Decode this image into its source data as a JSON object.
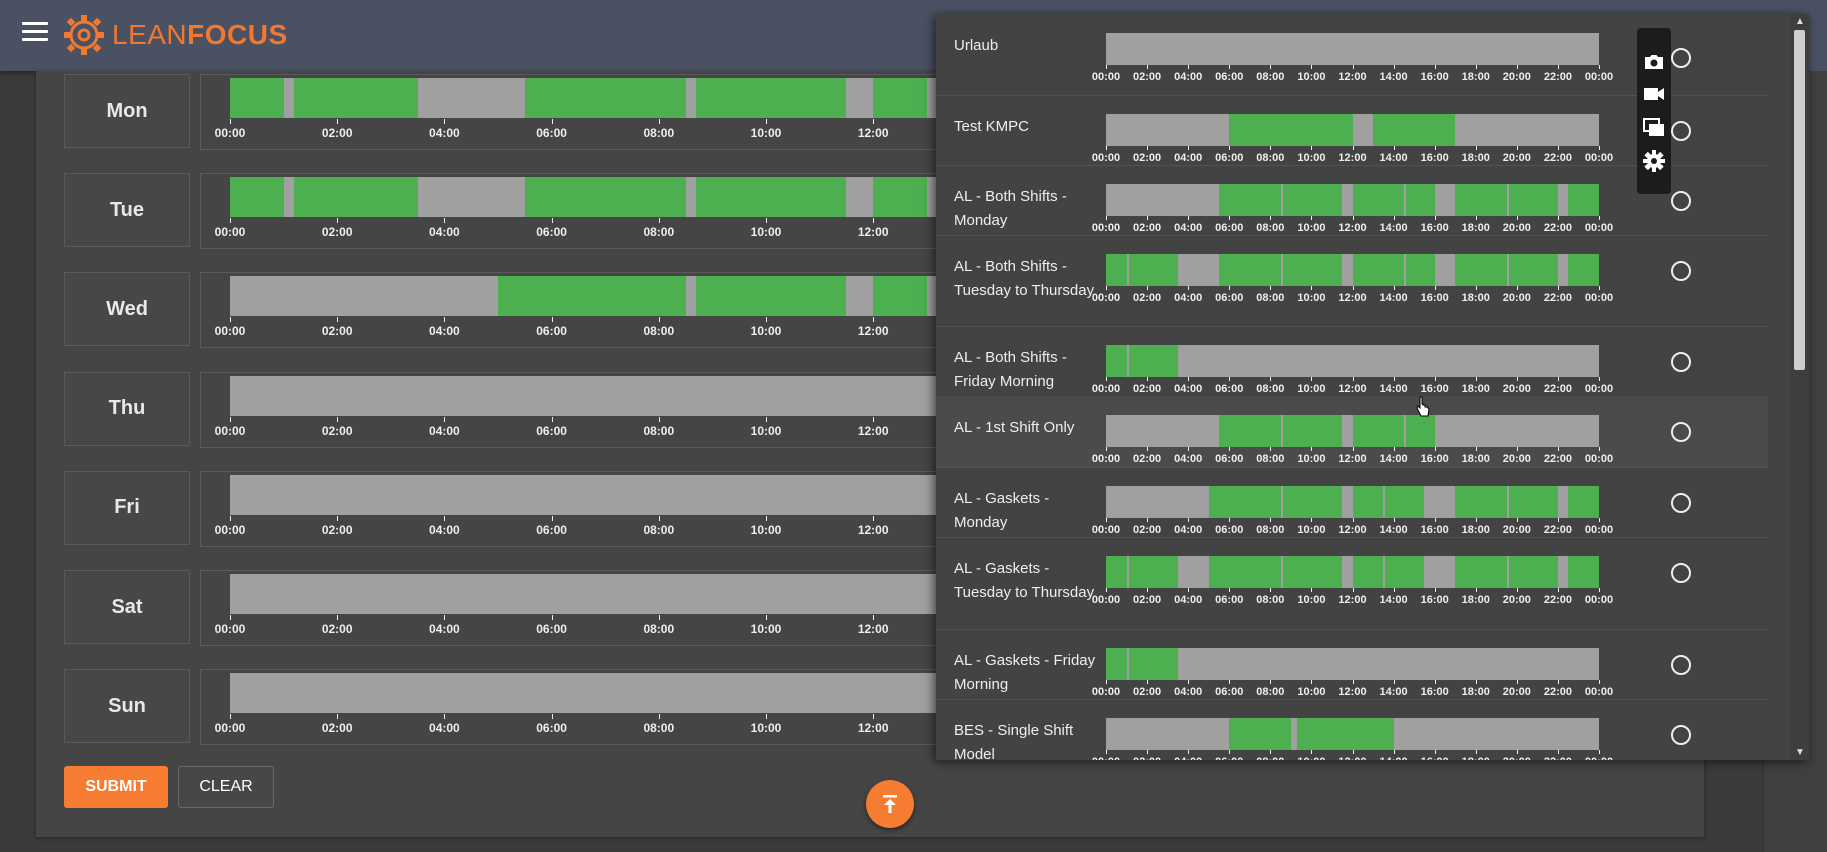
{
  "app": {
    "logo_text_light": "LEAN",
    "logo_text_bold": "FOCUS"
  },
  "hours": [
    "00:00",
    "02:00",
    "04:00",
    "06:00",
    "08:00",
    "10:00",
    "12:00",
    "14:00",
    "16:00",
    "18:00",
    "20:00",
    "22:00",
    "00:00"
  ],
  "main_axis_visible": [
    "00:00",
    "02:00",
    "04:00",
    "06:00",
    "08:00",
    "10:00",
    "12:00"
  ],
  "days": [
    {
      "label": "Mon",
      "segments": [
        [
          0,
          1.0
        ],
        [
          1.2,
          3.5
        ],
        [
          5.5,
          8.5
        ],
        [
          8.7,
          11.5
        ],
        [
          12.0,
          13.0
        ]
      ]
    },
    {
      "label": "Tue",
      "segments": [
        [
          0,
          1.0
        ],
        [
          1.2,
          3.5
        ],
        [
          5.5,
          8.5
        ],
        [
          8.7,
          11.5
        ],
        [
          12.0,
          13.0
        ]
      ]
    },
    {
      "label": "Wed",
      "segments": [
        [
          5.0,
          8.5
        ],
        [
          8.7,
          11.5
        ],
        [
          12.0,
          13.0
        ]
      ]
    },
    {
      "label": "Thu",
      "segments": []
    },
    {
      "label": "Fri",
      "segments": []
    },
    {
      "label": "Sat",
      "segments": []
    },
    {
      "label": "Sun",
      "segments": []
    }
  ],
  "buttons": {
    "submit": "SUBMIT",
    "clear": "CLEAR"
  },
  "models": [
    {
      "name": "Urlaub",
      "segments": []
    },
    {
      "name": "Test KMPC",
      "segments": [
        [
          6.0,
          12.0
        ],
        [
          13.0,
          17.0
        ]
      ]
    },
    {
      "name": "AL - Both Shifts - Monday",
      "segments": [
        [
          5.5,
          8.5
        ],
        [
          8.6,
          11.5
        ],
        [
          12.0,
          14.5
        ],
        [
          14.6,
          16.0
        ],
        [
          17.0,
          19.5
        ],
        [
          19.6,
          22.0
        ],
        [
          22.5,
          24.0
        ]
      ]
    },
    {
      "name": "AL - Both Shifts - Tuesday to Thursday",
      "segments": [
        [
          0,
          1.0
        ],
        [
          1.1,
          3.5
        ],
        [
          5.5,
          8.5
        ],
        [
          8.6,
          11.5
        ],
        [
          12.0,
          14.5
        ],
        [
          14.6,
          16.0
        ],
        [
          17.0,
          19.5
        ],
        [
          19.6,
          22.0
        ],
        [
          22.5,
          24.0
        ]
      ]
    },
    {
      "name": "AL - Both Shifts - Friday Morning",
      "segments": [
        [
          0,
          1.0
        ],
        [
          1.1,
          3.5
        ]
      ]
    },
    {
      "name": "AL - 1st Shift Only",
      "segments": [
        [
          5.5,
          8.5
        ],
        [
          8.6,
          11.5
        ],
        [
          12.0,
          14.5
        ],
        [
          14.6,
          16.0
        ]
      ]
    },
    {
      "name": "AL - Gaskets - Monday",
      "segments": [
        [
          5.0,
          8.5
        ],
        [
          8.6,
          11.5
        ],
        [
          12.0,
          13.5
        ],
        [
          13.6,
          15.5
        ],
        [
          17.0,
          19.5
        ],
        [
          19.6,
          22.0
        ],
        [
          22.5,
          24.0
        ]
      ]
    },
    {
      "name": "AL - Gaskets - Tuesday to Thursday",
      "segments": [
        [
          0,
          1.0
        ],
        [
          1.1,
          3.5
        ],
        [
          5.0,
          8.5
        ],
        [
          8.6,
          11.5
        ],
        [
          12.0,
          13.5
        ],
        [
          13.6,
          15.5
        ],
        [
          17.0,
          19.5
        ],
        [
          19.6,
          22.0
        ],
        [
          22.5,
          24.0
        ]
      ]
    },
    {
      "name": "AL - Gaskets - Friday Morning",
      "segments": [
        [
          0,
          1.0
        ],
        [
          1.1,
          3.5
        ]
      ]
    },
    {
      "name": "BES - Single Shift Model",
      "segments": [
        [
          6.0,
          9.0
        ],
        [
          9.3,
          14.0
        ]
      ]
    }
  ],
  "colors": {
    "active": "#4caf50",
    "inactive": "#a0a0a0",
    "accent": "#f57c30"
  },
  "icons": [
    "menu-icon",
    "logo-gear-icon",
    "camera-icon",
    "video-icon",
    "windows-icon",
    "settings-gear-icon",
    "scroll-to-top-icon",
    "mouse-pointer-icon"
  ]
}
